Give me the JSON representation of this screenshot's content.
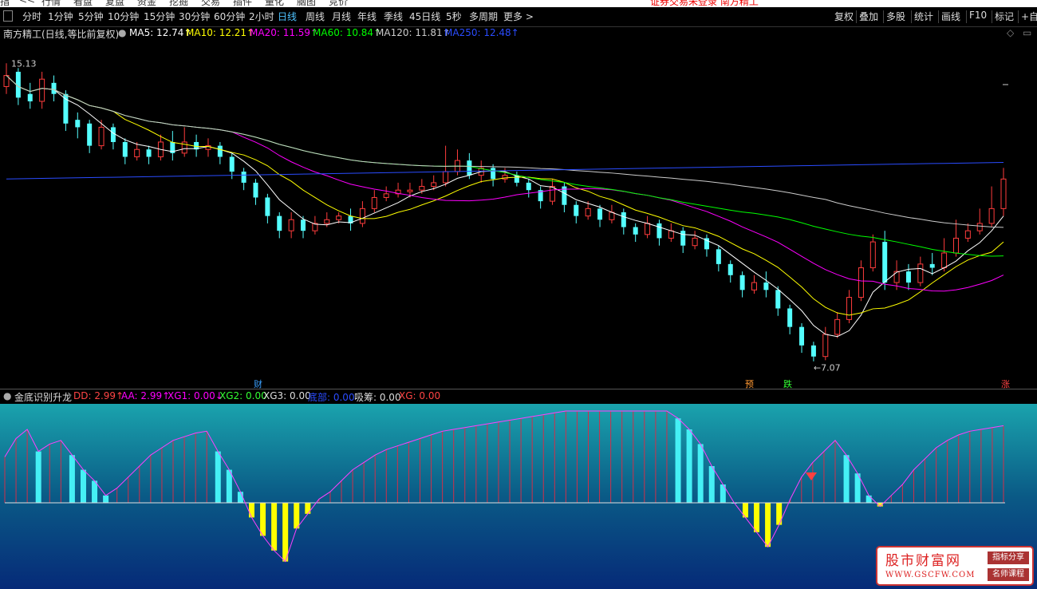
{
  "top_menu": {
    "items": [
      "指",
      "<<",
      "行情",
      "看盘",
      "复盘",
      "资金",
      "挖掘",
      "交易",
      "插件",
      "量化",
      "脑图",
      "竞价"
    ],
    "warning": "证券交易未登录  南方精工"
  },
  "toolbar": {
    "periods": [
      "分时",
      "1分钟",
      "5分钟",
      "10分钟",
      "15分钟",
      "30分钟",
      "60分钟",
      "2小时",
      "日线",
      "周线",
      "月线",
      "年线",
      "季线",
      "45日线",
      "5秒",
      "多周期",
      "更多 >"
    ],
    "active_period": "日线",
    "right_items": [
      "复权",
      "叠加",
      "多股",
      "统计",
      "画线",
      "F10",
      "标记",
      "+自选"
    ]
  },
  "main_info": {
    "stock": "南方精工(日线,等比前复权)",
    "ma5": "MA5: 12.74↑",
    "ma10": "MA10: 12.21↑",
    "ma20": "MA20: 11.59↑",
    "ma60": "MA60: 10.84↑",
    "ma120": "MA120: 11.81↑",
    "ma250": "MA250: 12.48↑",
    "colors": {
      "ma5": "#ffffff",
      "ma10": "#ffff00",
      "ma20": "#ff00ff",
      "ma60": "#00ff00",
      "ma120": "#cccccc",
      "ma250": "#2a4cff",
      "up": "#ff3c3c",
      "down": "#54ffff"
    }
  },
  "price_labels": {
    "high": "15.13",
    "low": "←7.07"
  },
  "event_markers": [
    {
      "text": "财",
      "color": "#3aa0ff"
    },
    {
      "text": "预",
      "color": "#ff9933"
    },
    {
      "text": "跌",
      "color": "#33ff33"
    },
    {
      "text": "涨",
      "color": "#ff4444"
    }
  ],
  "sub_info": {
    "title": "金底识别升龙",
    "dd": "DD: 2.99↑",
    "aa": "AA: 2.99↑",
    "xg1": "XG1: 0.00↓",
    "xg2": "XG2: 0.00",
    "xg3": "XG3: 0.00",
    "bottom": "底部: 0.00",
    "chip": "吸筹: 0.00",
    "xg": "XG: 0.00"
  },
  "watermark": {
    "title": "股市财富网",
    "url": "WWW.GSCFW.COM",
    "tag1": "指标分享",
    "tag2": "名师课程"
  },
  "chart_data": {
    "type": "candlestick",
    "price_range": [
      7.07,
      15.13
    ],
    "candles": [
      [
        14.5,
        14.8,
        15.13,
        14.3
      ],
      [
        14.9,
        14.2,
        15.0,
        14.0
      ],
      [
        14.3,
        14.1,
        14.6,
        13.9
      ],
      [
        14.1,
        14.7,
        14.9,
        13.9
      ],
      [
        14.6,
        14.3,
        14.8,
        14.1
      ],
      [
        14.3,
        13.5,
        14.4,
        13.3
      ],
      [
        13.6,
        13.4,
        13.8,
        13.1
      ],
      [
        13.5,
        12.9,
        13.6,
        12.7
      ],
      [
        12.9,
        13.4,
        13.6,
        12.8
      ],
      [
        13.4,
        13.0,
        13.5,
        12.8
      ],
      [
        13.0,
        12.6,
        13.1,
        12.4
      ],
      [
        12.6,
        12.8,
        13.0,
        12.5
      ],
      [
        12.8,
        12.6,
        12.9,
        12.4
      ],
      [
        12.6,
        13.0,
        13.2,
        12.5
      ],
      [
        13.0,
        12.7,
        13.3,
        12.5
      ],
      [
        12.7,
        13.0,
        13.4,
        12.6
      ],
      [
        13.0,
        12.8,
        13.2,
        12.6
      ],
      [
        12.8,
        12.9,
        13.1,
        12.6
      ],
      [
        12.9,
        12.6,
        13.0,
        12.4
      ],
      [
        12.6,
        12.2,
        12.7,
        12.0
      ],
      [
        12.2,
        11.9,
        12.3,
        11.7
      ],
      [
        11.9,
        11.5,
        12.0,
        11.3
      ],
      [
        11.5,
        11.0,
        11.6,
        10.8
      ],
      [
        11.0,
        10.6,
        11.1,
        10.4
      ],
      [
        10.6,
        10.9,
        11.1,
        10.4
      ],
      [
        10.9,
        10.6,
        11.0,
        10.4
      ],
      [
        10.6,
        10.8,
        11.0,
        10.5
      ],
      [
        10.8,
        10.9,
        11.1,
        10.7
      ],
      [
        10.9,
        11.0,
        11.1,
        10.8
      ],
      [
        11.0,
        10.8,
        11.2,
        10.6
      ],
      [
        10.8,
        11.2,
        11.4,
        10.7
      ],
      [
        11.2,
        11.5,
        11.7,
        11.1
      ],
      [
        11.5,
        11.6,
        11.8,
        11.4
      ],
      [
        11.6,
        11.7,
        11.9,
        11.5
      ],
      [
        11.7,
        11.7,
        11.9,
        11.5
      ],
      [
        11.7,
        11.8,
        12.0,
        11.6
      ],
      [
        11.8,
        11.9,
        12.1,
        11.7
      ],
      [
        11.9,
        12.2,
        12.9,
        11.8
      ],
      [
        12.2,
        12.5,
        12.8,
        12.1
      ],
      [
        12.5,
        12.1,
        12.7,
        12.0
      ],
      [
        12.1,
        12.3,
        12.5,
        11.9
      ],
      [
        12.3,
        12.0,
        12.4,
        11.8
      ],
      [
        12.0,
        12.1,
        12.3,
        11.9
      ],
      [
        12.1,
        11.9,
        12.2,
        11.8
      ],
      [
        11.9,
        11.7,
        12.0,
        11.5
      ],
      [
        11.7,
        11.4,
        11.8,
        11.2
      ],
      [
        11.4,
        11.8,
        12.0,
        11.3
      ],
      [
        11.8,
        11.3,
        11.9,
        11.1
      ],
      [
        11.3,
        11.0,
        11.4,
        10.8
      ],
      [
        11.0,
        11.2,
        11.4,
        10.9
      ],
      [
        11.2,
        10.9,
        11.3,
        10.7
      ],
      [
        10.9,
        11.1,
        11.3,
        10.8
      ],
      [
        11.1,
        10.7,
        11.2,
        10.5
      ],
      [
        10.7,
        10.5,
        10.8,
        10.3
      ],
      [
        10.5,
        10.8,
        11.0,
        10.4
      ],
      [
        10.8,
        10.4,
        10.9,
        10.2
      ],
      [
        10.4,
        10.6,
        10.8,
        10.3
      ],
      [
        10.6,
        10.2,
        10.7,
        10.0
      ],
      [
        10.2,
        10.4,
        10.6,
        10.1
      ],
      [
        10.4,
        10.1,
        10.5,
        9.9
      ],
      [
        10.1,
        9.7,
        10.2,
        9.5
      ],
      [
        9.7,
        9.4,
        9.8,
        9.2
      ],
      [
        9.4,
        9.0,
        9.5,
        8.8
      ],
      [
        9.0,
        9.2,
        9.4,
        8.9
      ],
      [
        9.2,
        9.0,
        9.5,
        8.8
      ],
      [
        9.0,
        8.5,
        9.1,
        8.3
      ],
      [
        8.5,
        8.0,
        8.6,
        7.8
      ],
      [
        8.0,
        7.5,
        8.1,
        7.3
      ],
      [
        7.5,
        7.2,
        7.6,
        7.07
      ],
      [
        7.2,
        7.8,
        8.0,
        7.1
      ],
      [
        7.8,
        8.2,
        8.4,
        7.7
      ],
      [
        8.2,
        8.8,
        9.0,
        8.1
      ],
      [
        8.8,
        9.6,
        9.8,
        8.7
      ],
      [
        9.6,
        10.3,
        10.5,
        9.5
      ],
      [
        10.3,
        9.2,
        10.6,
        9.0
      ],
      [
        9.2,
        9.5,
        9.8,
        9.0
      ],
      [
        9.5,
        9.2,
        9.7,
        9.0
      ],
      [
        9.2,
        9.7,
        9.9,
        9.1
      ],
      [
        9.7,
        9.6,
        10.0,
        9.4
      ],
      [
        9.6,
        10.0,
        10.4,
        9.5
      ],
      [
        10.0,
        10.4,
        10.9,
        9.9
      ],
      [
        10.4,
        10.6,
        10.8,
        10.3
      ],
      [
        10.6,
        10.8,
        11.2,
        10.5
      ],
      [
        10.8,
        11.2,
        11.8,
        10.7
      ],
      [
        11.2,
        12.0,
        12.3,
        11.0
      ]
    ],
    "ma_note": "MA5, MA10, MA20, MA60, MA120, MA250 overlays",
    "sub_indicator": {
      "name": "金底识别升龙",
      "values": [
        2.5,
        3.5,
        4,
        2.8,
        3.2,
        3.4,
        2.6,
        1.8,
        1.2,
        0.4,
        0.8,
        1.4,
        2.0,
        2.6,
        3.0,
        3.4,
        3.6,
        3.8,
        3.9,
        2.8,
        1.8,
        0.6,
        -0.8,
        -1.8,
        -2.6,
        -3.2,
        -1.4,
        -0.6,
        0.2,
        0.6,
        1.2,
        1.8,
        2.2,
        2.6,
        2.9,
        3.1,
        3.3,
        3.5,
        3.7,
        3.9,
        4.0,
        4.1,
        4.2,
        4.3,
        4.4,
        4.5,
        4.6,
        4.7,
        4.8,
        4.9,
        5.0,
        5.0,
        5.0,
        5.0,
        5.0,
        5.0,
        5.0,
        5.0,
        5.0,
        5.0,
        4.6,
        4.0,
        3.2,
        2.0,
        1.0,
        0.0,
        -0.8,
        -1.6,
        -2.4,
        -1.2,
        0.2,
        1.4,
        2.2,
        2.8,
        3.4,
        2.6,
        1.6,
        0.4,
        -0.2,
        0.4,
        1.0,
        1.8,
        2.4,
        3.0,
        3.4,
        3.7,
        3.9,
        4.0,
        4.1,
        4.2
      ]
    }
  }
}
